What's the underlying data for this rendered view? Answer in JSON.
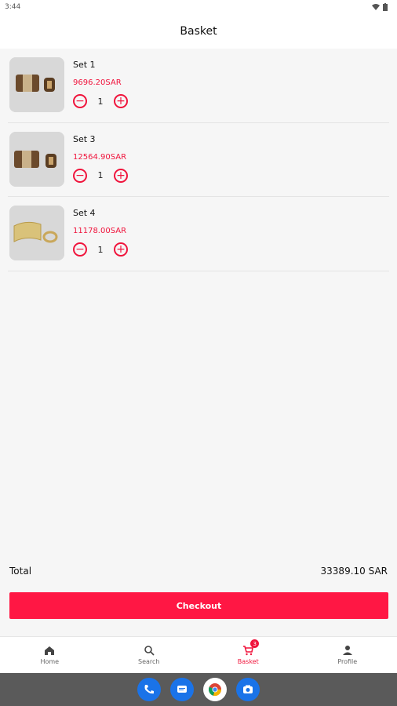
{
  "status_bar": {
    "time": "3:44"
  },
  "header": {
    "title": "Basket"
  },
  "items": [
    {
      "name": "Set 1",
      "price": "9696.20SAR",
      "quantity": "1"
    },
    {
      "name": "Set 3",
      "price": "12564.90SAR",
      "quantity": "1"
    },
    {
      "name": "Set 4",
      "price": "11178.00SAR",
      "quantity": "1"
    }
  ],
  "summary": {
    "total_label": "Total",
    "total_value": "33389.10 SAR"
  },
  "checkout": {
    "label": "Checkout"
  },
  "bottom_nav": {
    "items": [
      {
        "label": "Home",
        "icon": "home-icon"
      },
      {
        "label": "Search",
        "icon": "search-icon"
      },
      {
        "label": "Basket",
        "icon": "cart-icon",
        "badge": "3"
      },
      {
        "label": "Profile",
        "icon": "person-icon"
      }
    ]
  },
  "dock": {
    "apps": [
      {
        "icon": "phone-icon",
        "color": "#1a73e8"
      },
      {
        "icon": "messages-icon",
        "color": "#1a73e8"
      },
      {
        "icon": "chrome-icon",
        "color": "#ffffff"
      },
      {
        "icon": "camera-icon",
        "color": "#1a73e8"
      }
    ]
  },
  "colors": {
    "accent": "#ff1744",
    "price": "#f0143c",
    "background": "#f6f6f6"
  }
}
